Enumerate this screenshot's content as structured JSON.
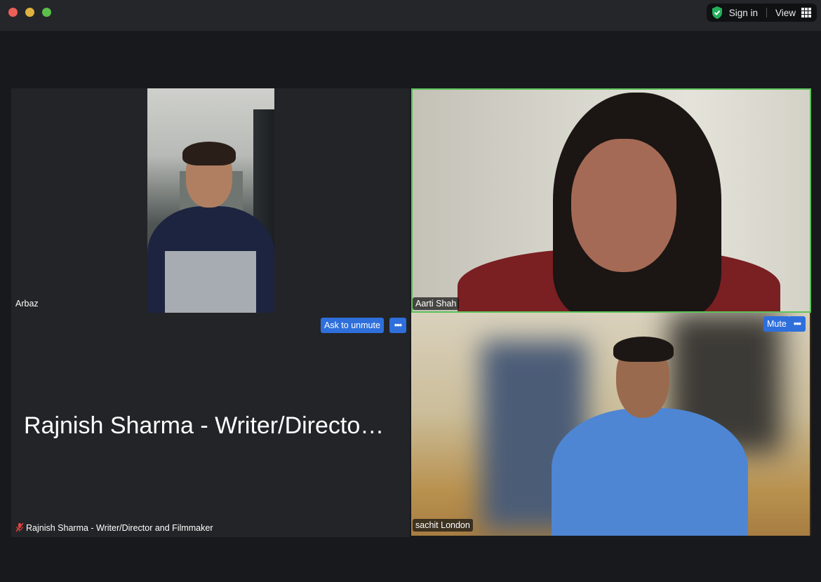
{
  "colors": {
    "active_speaker_border": "#5cc25a",
    "button_blue": "#2e6fdc",
    "background": "#18191c",
    "tile": "#232427"
  },
  "header": {
    "shield_icon": "shield-check-icon",
    "sign_in": "Sign in",
    "view": "View",
    "view_icon": "grid-icon"
  },
  "participants": [
    {
      "name": "Arbaz",
      "video": true
    },
    {
      "name": "Aarti Shah",
      "video": true,
      "active_speaker": true
    },
    {
      "name": "Rajnish Sharma - Writer/Director and Filmmaker",
      "display_name": "Rajnish Sharma - Writer/Directo…",
      "video": false,
      "muted": true,
      "muted_icon": "mic-off-icon",
      "actions": {
        "primary": "Ask to unmute",
        "more": "•••"
      }
    },
    {
      "name": "sachit London",
      "video": true,
      "actions": {
        "primary": "Mute",
        "more": "•••"
      }
    }
  ]
}
